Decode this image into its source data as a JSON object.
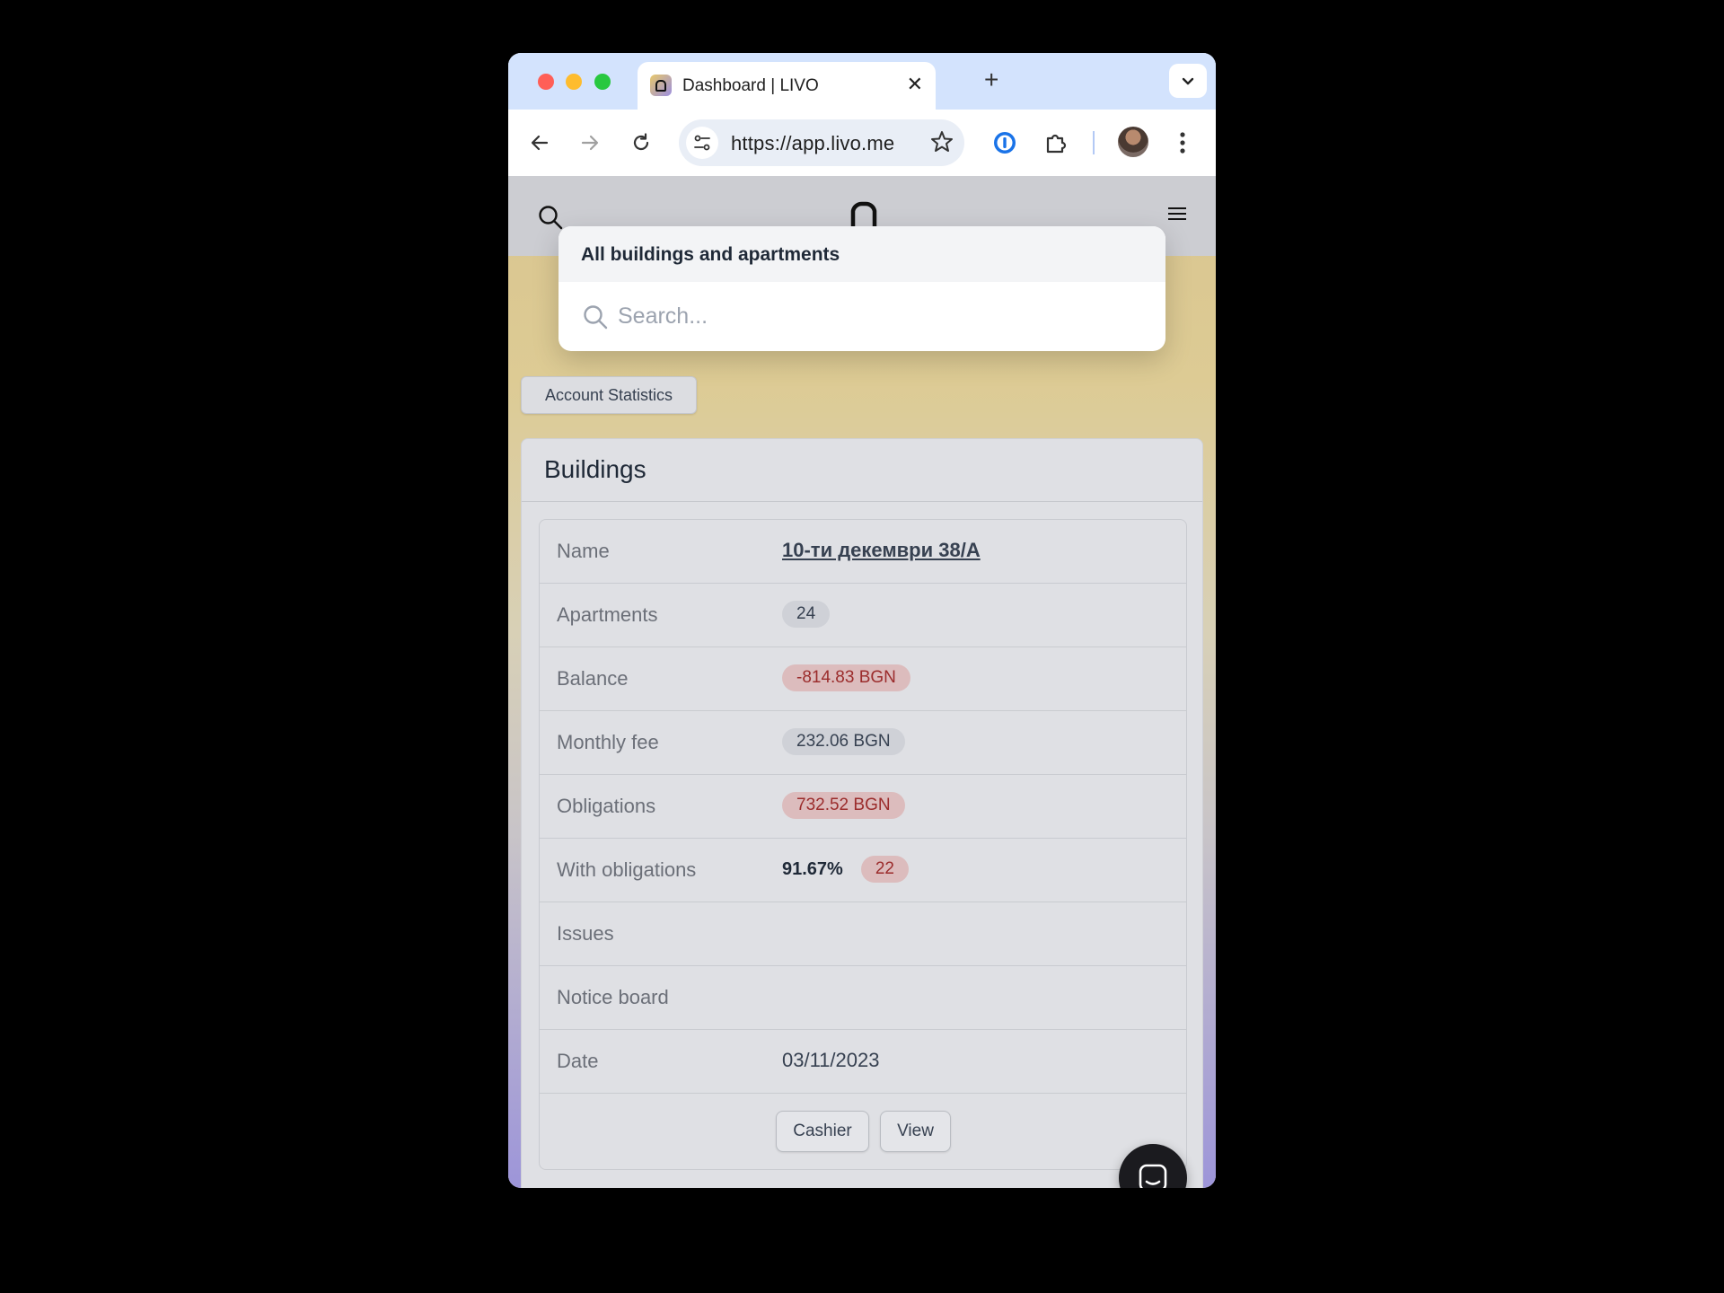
{
  "browser": {
    "tab_title": "Dashboard | LIVO",
    "tab_close": "✕",
    "new_tab": "+",
    "url": "https://app.livo.me"
  },
  "dropdown": {
    "heading": "All buildings and apartments",
    "search_placeholder": "Search..."
  },
  "account_statistics_label": "Account Statistics",
  "buildings": {
    "title": "Buildings",
    "rows": [
      {
        "label": "Name",
        "value": "10-ти декември 38/А"
      },
      {
        "label": "Apartments",
        "value": "24"
      },
      {
        "label": "Balance",
        "value": "-814.83 BGN"
      },
      {
        "label": "Monthly fee",
        "value": "232.06 BGN"
      },
      {
        "label": "Obligations",
        "value": "732.52 BGN"
      },
      {
        "label": "With obligations",
        "value": "91.67%",
        "count": "22"
      },
      {
        "label": "Issues",
        "value": ""
      },
      {
        "label": "Notice board",
        "value": ""
      },
      {
        "label": "Date",
        "value": "03/11/2023"
      }
    ],
    "actions": {
      "cashier": "Cashier",
      "view": "View"
    }
  },
  "colors": {
    "danger_badge_bg": "#dcbcbd",
    "danger_text": "#9b2c2c",
    "neutral_badge_bg": "#cfd1d7",
    "chrome_tabstrip": "#d3e3fd"
  },
  "icons": [
    "search-icon",
    "logo-icon",
    "hamburger-menu-icon",
    "chat-icon",
    "star-icon",
    "extensions-icon",
    "password-manager-icon"
  ]
}
